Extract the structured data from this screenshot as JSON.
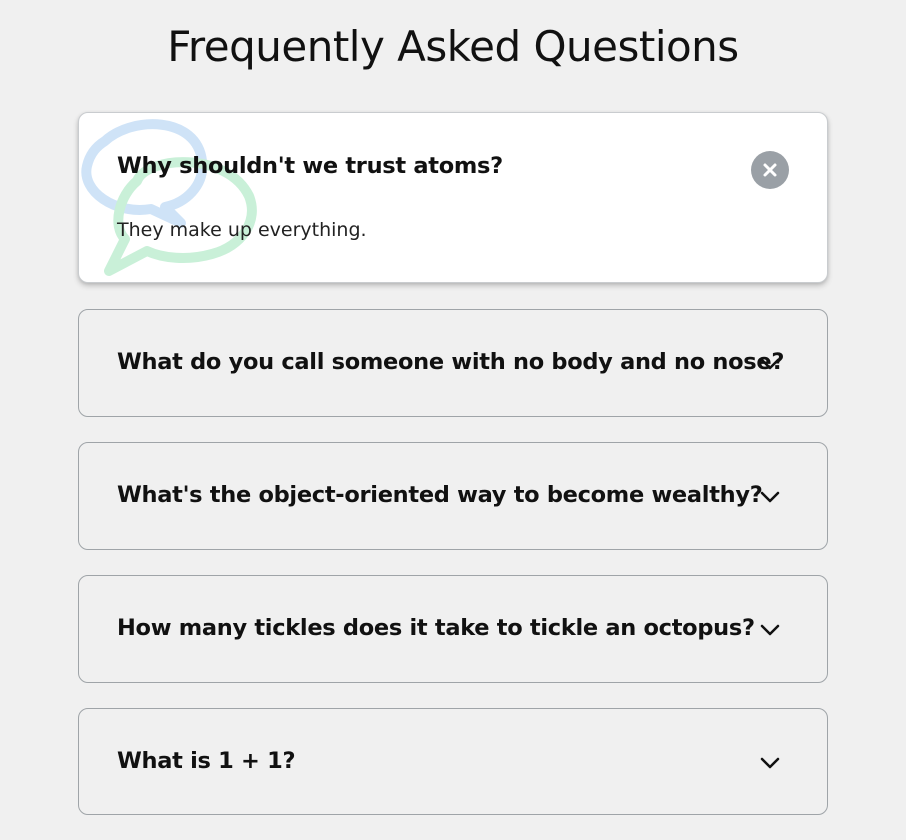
{
  "page": {
    "title": "Frequently Asked Questions"
  },
  "faqs": [
    {
      "question": "Why shouldn't we trust atoms?",
      "answer": "They make up everything.",
      "expanded": true,
      "toggle_icon": "close-icon"
    },
    {
      "question": "What do you call someone with no body and no nose?",
      "expanded": false,
      "toggle_icon": "chevron-down-icon"
    },
    {
      "question": "What's the object-oriented way to become wealthy?",
      "expanded": false,
      "toggle_icon": "chevron-down-icon"
    },
    {
      "question": "How many tickles does it take to tickle an octopus?",
      "expanded": false,
      "toggle_icon": "chevron-down-icon"
    },
    {
      "question": "What is 1 + 1?",
      "expanded": false,
      "toggle_icon": "chevron-down-icon"
    }
  ],
  "colors": {
    "background": "#f0f0f0",
    "active_card": "#ffffff",
    "close_button": "#9aa0a6",
    "bubble_blue": "#cfe3f7",
    "bubble_green": "#c9f0d8"
  }
}
